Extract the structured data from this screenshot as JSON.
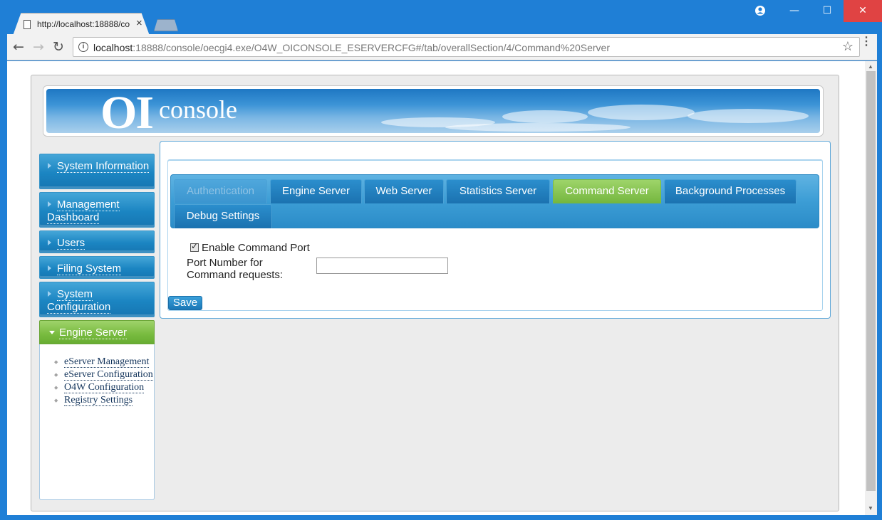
{
  "browser": {
    "tab_title": "http://localhost:18888/co",
    "url_host": "localhost",
    "url_rest": ":18888/console/oecgi4.exe/O4W_OICONSOLE_ESERVERCFG#/tab/overallSection/4/Command%20Server",
    "tab_close": "×",
    "back_icon": "←",
    "forward_icon": "→",
    "reload_icon": "↻",
    "star_icon": "☆",
    "menu_icon": "⋮",
    "minimize_icon": "—",
    "maximize_icon": "☐",
    "close_icon": "✕"
  },
  "logo": {
    "oi": "OI",
    "console": "console"
  },
  "sidebar": {
    "items": [
      {
        "label": "System Information"
      },
      {
        "label": "Management Dashboard"
      },
      {
        "label": "Users"
      },
      {
        "label": "Filing System"
      },
      {
        "label": "System Configuration"
      }
    ],
    "active": {
      "label": "Engine Server"
    },
    "sub_items": [
      {
        "label": "eServer Management"
      },
      {
        "label": "eServer Configuration"
      },
      {
        "label": "O4W Configuration"
      },
      {
        "label": "Registry Settings"
      }
    ]
  },
  "tabs": [
    {
      "label": "Authentication",
      "state": "disabled"
    },
    {
      "label": "Engine Server",
      "state": "normal"
    },
    {
      "label": "Web Server",
      "state": "normal"
    },
    {
      "label": "Statistics Server",
      "state": "normal"
    },
    {
      "label": "Command Server",
      "state": "selected"
    },
    {
      "label": "Background Processes",
      "state": "normal"
    },
    {
      "label": "Debug Settings",
      "state": "normal"
    }
  ],
  "form": {
    "enable_label": "Enable Command Port",
    "enable_checked": true,
    "port_label": "Port Number for Command requests:",
    "port_value": ""
  },
  "actions": {
    "save_label": "Save"
  },
  "colors": {
    "frame_blue": "#1f7fd6",
    "nav_blue": "#1b85c2",
    "active_green": "#78bb3f",
    "close_red": "#e04343"
  }
}
